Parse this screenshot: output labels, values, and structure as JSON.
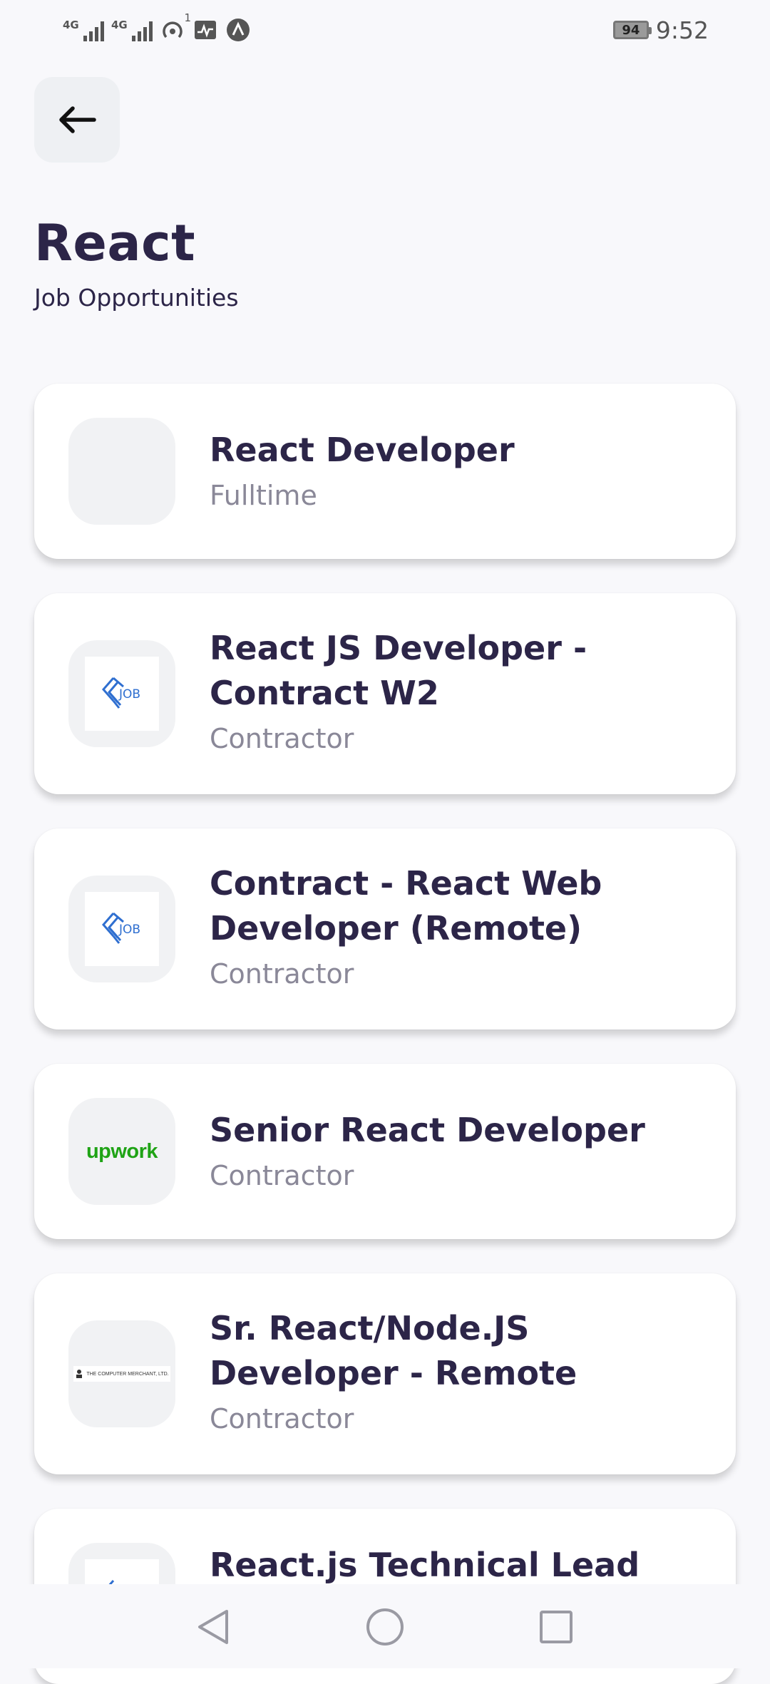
{
  "status_bar": {
    "signal1_label": "4G",
    "signal2_label": "4G",
    "hotspot_count": "1",
    "battery": "94",
    "time": "9:52"
  },
  "header": {
    "title": "React",
    "subtitle": "Job Opportunities"
  },
  "jobs": [
    {
      "title": "React Developer",
      "type": "Fulltime",
      "logo": "blank"
    },
    {
      "title": "React JS Developer - Contract W2",
      "type": "Contractor",
      "logo": "job-logo"
    },
    {
      "title": "Contract - React Web Developer (Remote)",
      "type": "Contractor",
      "logo": "job-logo"
    },
    {
      "title": "Senior React Developer",
      "type": "Contractor",
      "logo": "upwork",
      "logo_text": "upwork"
    },
    {
      "title": "Sr. React/Node.JS Developer - Remote",
      "type": "Contractor",
      "logo": "computer-merchant",
      "logo_text": "THE COMPUTER MERCHANT, LTD."
    },
    {
      "title": "React.js Technical Lead",
      "type": "",
      "logo": "job-logo"
    }
  ],
  "colors": {
    "title": "#2c2548",
    "secondary_text": "#8a8898",
    "logo_blue": "#2f6fd0",
    "upwork_green": "#1fa315"
  }
}
